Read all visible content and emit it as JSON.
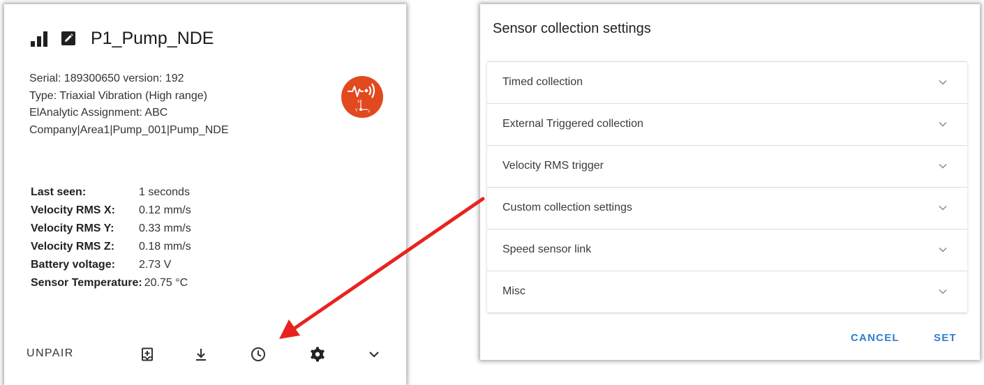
{
  "sensor_card": {
    "title": "P1_Pump_NDE",
    "info_lines": [
      "Serial: 189300650 version: 192",
      "Type: Triaxial Vibration (High range)",
      "ElAnalytic Assignment: ABC",
      "Company|Area1|Pump_001|Pump_NDE"
    ],
    "badge_icon": "triaxial-vibration-icon",
    "badge_color": "#e2491e",
    "stats": [
      {
        "label": "Last seen:",
        "value": "1 seconds"
      },
      {
        "label": "Velocity RMS X:",
        "value": "0.12 mm/s"
      },
      {
        "label": "Velocity RMS Y:",
        "value": "0.33 mm/s"
      },
      {
        "label": "Velocity RMS Z:",
        "value": "0.18 mm/s"
      },
      {
        "label": "Battery voltage:",
        "value": "2.73 V"
      },
      {
        "label": "Sensor Temperature:",
        "value": "20.75 °C"
      }
    ],
    "actions": {
      "unpair_label": "UNPAIR",
      "icons": [
        "bookmark-add-icon",
        "download-icon",
        "clock-icon",
        "gear-icon",
        "chevron-down-icon"
      ]
    }
  },
  "dialog": {
    "title": "Sensor collection settings",
    "panels": [
      {
        "label": "Timed collection"
      },
      {
        "label": "External Triggered collection"
      },
      {
        "label": "Velocity RMS trigger"
      },
      {
        "label": "Custom collection settings"
      },
      {
        "label": "Speed sensor link"
      },
      {
        "label": "Misc"
      }
    ],
    "cancel_label": "CANCEL",
    "set_label": "SET",
    "accent_color": "#2c7fd1"
  },
  "annotation": {
    "arrow_color": "#e8231f"
  }
}
